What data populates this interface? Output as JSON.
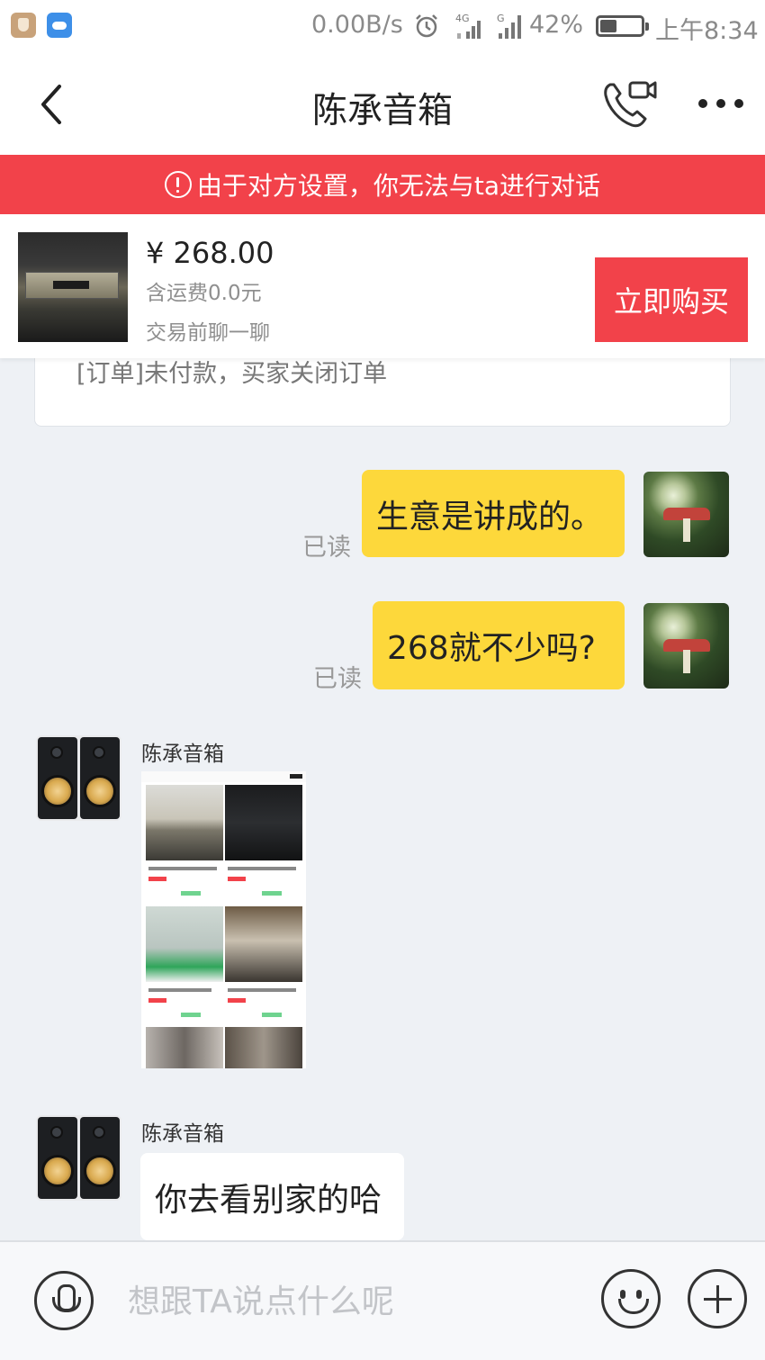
{
  "status_bar": {
    "network_speed": "0.00B/s",
    "network_type": "4G",
    "battery_percent": "42%",
    "battery_level": 0.42,
    "time": "上午8:34",
    "icons": [
      "security-app-icon",
      "cloud-app-icon",
      "alarm-icon",
      "4g-signal-icon",
      "signal-icon",
      "battery-icon"
    ]
  },
  "header": {
    "title": "陈承音箱",
    "icons": [
      "back-arrow-icon",
      "video-call-icon",
      "more-icon"
    ]
  },
  "warning": {
    "text": "由于对方设置，你无法与ta进行对话",
    "color": "#f2424a"
  },
  "product": {
    "price": "¥ 268.00",
    "shipping": "含运费0.0元",
    "hint": "交易前聊一聊",
    "buy_label": "立即购买",
    "accent": "#f2424a"
  },
  "chat": {
    "system_message": "[订单]未付款，买家关闭订单",
    "messages": [
      {
        "from": "me",
        "text": "生意是讲成的。",
        "status": "已读"
      },
      {
        "from": "me",
        "text": "268就不少吗?",
        "status": "已读"
      },
      {
        "from": "other",
        "sender": "陈承音箱",
        "type": "image"
      },
      {
        "from": "other",
        "sender": "陈承音箱",
        "text": "你去看别家的哈"
      }
    ],
    "bubble_color_me": "#fdd83b"
  },
  "input_bar": {
    "placeholder": "想跟TA说点什么呢",
    "icons": [
      "microphone-icon",
      "emoji-icon",
      "plus-icon"
    ]
  }
}
